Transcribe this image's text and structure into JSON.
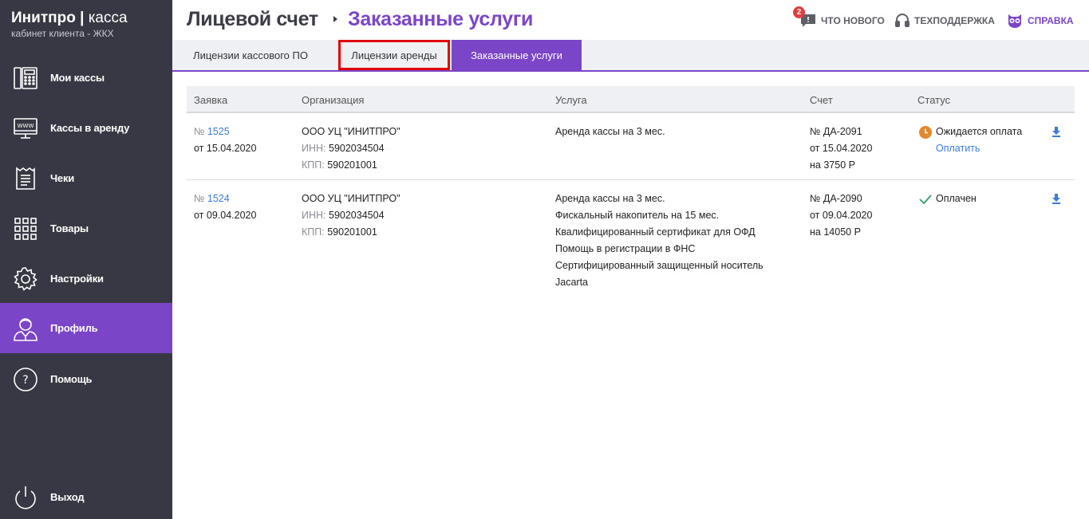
{
  "brand": {
    "name_bold": "Инитпро",
    "separator": "|",
    "name_thin": "касса",
    "subtitle": "кабинет клиента - ЖКХ"
  },
  "sidebar": {
    "items": [
      {
        "label": "Мои кассы",
        "icon": "cash-register-icon"
      },
      {
        "label": "Кассы в аренду",
        "icon": "www-monitor-icon"
      },
      {
        "label": "Чеки",
        "icon": "receipt-icon"
      },
      {
        "label": "Товары",
        "icon": "grid-icon"
      },
      {
        "label": "Настройки",
        "icon": "gear-icon"
      },
      {
        "label": "Профиль",
        "icon": "user-icon",
        "active": true
      },
      {
        "label": "Помощь",
        "icon": "question-icon"
      }
    ],
    "logout": {
      "label": "Выход",
      "icon": "power-icon"
    }
  },
  "header": {
    "breadcrumb_root": "Лицевой счет",
    "breadcrumb_current": "Заказанные услуги",
    "whats_new": {
      "label": "ЧТО НОВОГО",
      "badge": "2"
    },
    "support": {
      "label": "ТЕХПОДДЕРЖКА"
    },
    "help": {
      "label": "СПРАВКА"
    }
  },
  "tabs": [
    {
      "label": "Лицензии кассового ПО"
    },
    {
      "label": "Лицензии аренды",
      "highlighted": true
    },
    {
      "label": "Заказанные услуги",
      "active": true
    }
  ],
  "table": {
    "columns": [
      "Заявка",
      "Организация",
      "Услуга",
      "Счет",
      "Статус"
    ],
    "rows": [
      {
        "order_prefix": "№",
        "order_number": "1525",
        "order_date": "от 15.04.2020",
        "org_name": "ООО УЦ \"ИНИТПРО\"",
        "inn_label": "ИНН:",
        "inn": "5902034504",
        "kpp_label": "КПП:",
        "kpp": "590201001",
        "services": [
          "Аренда кассы на 3 мес."
        ],
        "invoice_number": "№ ДА-2091",
        "invoice_date_prefix": "от",
        "invoice_date": "15.04.2020",
        "invoice_sum_prefix": "на",
        "invoice_sum": "3750 Р",
        "status": "Ожидается оплата",
        "status_icon": "clock-icon",
        "action": "Оплатить"
      },
      {
        "order_prefix": "№",
        "order_number": "1524",
        "order_date": "от 09.04.2020",
        "org_name": "ООО УЦ \"ИНИТПРО\"",
        "inn_label": "ИНН:",
        "inn": "5902034504",
        "kpp_label": "КПП:",
        "kpp": "590201001",
        "services": [
          "Аренда кассы на 3 мес.",
          "Фискальный накопитель на 15 мес.",
          "Квалифицированный сертификат для ОФД",
          "Помощь в регистрации в ФНС",
          "Сертифицированный защищенный носитель",
          "Jacarta"
        ],
        "invoice_number": "№ ДА-2090",
        "invoice_date_prefix": "от",
        "invoice_date": "09.04.2020",
        "invoice_sum_prefix": "на",
        "invoice_sum": "14050 Р",
        "status": "Оплачен",
        "status_icon": "check-icon",
        "action": ""
      }
    ]
  },
  "colors": {
    "sidebar": "#373843",
    "accent": "#7a45c7",
    "link": "#3d7bd8",
    "pending": "#e0882a",
    "paid": "#2f9e6b",
    "badge": "#e03d3d"
  }
}
